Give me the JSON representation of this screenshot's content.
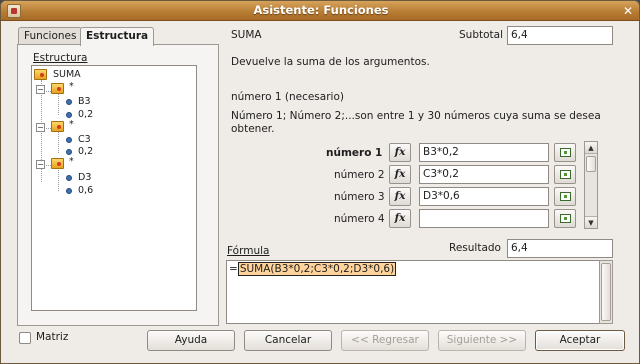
{
  "window": {
    "title": "Asistente: Funciones"
  },
  "tabs": [
    {
      "label": "Funciones"
    },
    {
      "label": "Estructura"
    }
  ],
  "structure": {
    "label": "Estructura",
    "tree": [
      {
        "text": "SUMA"
      },
      {
        "text": "*"
      },
      {
        "text": "B3"
      },
      {
        "text": "0,2"
      },
      {
        "text": "*"
      },
      {
        "text": "C3"
      },
      {
        "text": "0,2"
      },
      {
        "text": "*"
      },
      {
        "text": "D3"
      },
      {
        "text": "0,6"
      }
    ]
  },
  "function": {
    "name": "SUMA",
    "subtotal_label": "Subtotal",
    "subtotal_value": "6,4",
    "description": "Devuelve la suma de los argumentos.",
    "arg_heading": "número 1 (necesario)",
    "arg_description_line1": "Número 1; Número 2;...son entre 1 y 30 números cuya suma se desea",
    "arg_description_line2": "obtener."
  },
  "args": [
    {
      "label": "número 1",
      "value": "B3*0,2"
    },
    {
      "label": "número 2",
      "value": "C3*0,2"
    },
    {
      "label": "número 3",
      "value": "D3*0,6"
    },
    {
      "label": "número 4",
      "value": ""
    }
  ],
  "fx_label": "fx",
  "formula": {
    "label": "Fórmula",
    "result_label": "Resultado",
    "result_value": "6,4",
    "eq": "=",
    "text": "SUMA(B3*0,2;C3*0,2;D3*0,6)"
  },
  "matriz_label": "Matriz",
  "buttons": {
    "help": "Ayuda",
    "cancel": "Cancelar",
    "back": "<< Regresar",
    "next": "Siguiente >>",
    "ok": "Aceptar"
  }
}
